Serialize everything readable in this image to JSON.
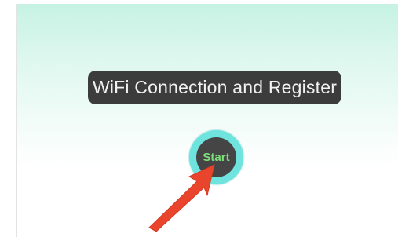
{
  "screen": {
    "title": "WiFi Connection and Register",
    "start_label": "Start"
  },
  "colors": {
    "background_top": "#c6f2e4",
    "title_pill": "#3c3c3c",
    "start_ring": "#6fe3de",
    "start_text": "#7de07a",
    "arrow": "#e8452c"
  },
  "annotation": {
    "icon": "pointer-arrow-icon"
  }
}
